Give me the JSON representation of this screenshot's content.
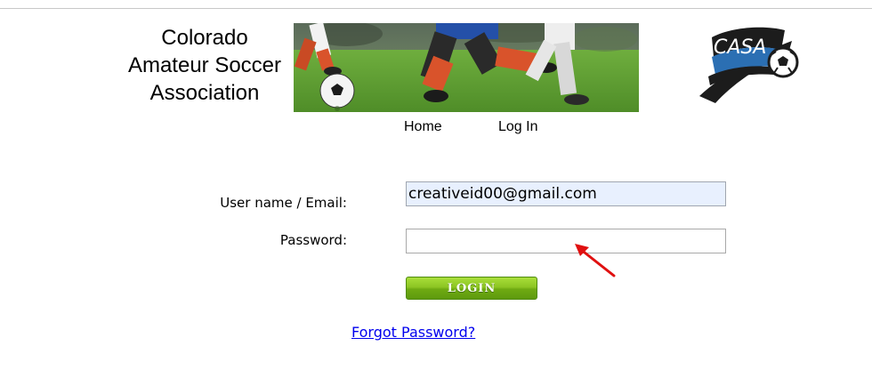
{
  "site": {
    "title_lines": [
      "Colorado",
      "Amateur Soccer",
      "Association"
    ],
    "logo_text": "CASA"
  },
  "nav": {
    "home_label": "Home",
    "login_label": "Log In"
  },
  "form": {
    "username_label": "User name / Email:",
    "username_value": "creativeid00@gmail.com",
    "password_label": "Password:",
    "password_value": "",
    "login_button_label": "LOGIN",
    "forgot_password_label": "Forgot Password?"
  },
  "colors": {
    "login_button": "#8cc523",
    "link": "#0000ee",
    "autofill_background": "#e8f0fe",
    "annotation_arrow": "#e01010"
  }
}
